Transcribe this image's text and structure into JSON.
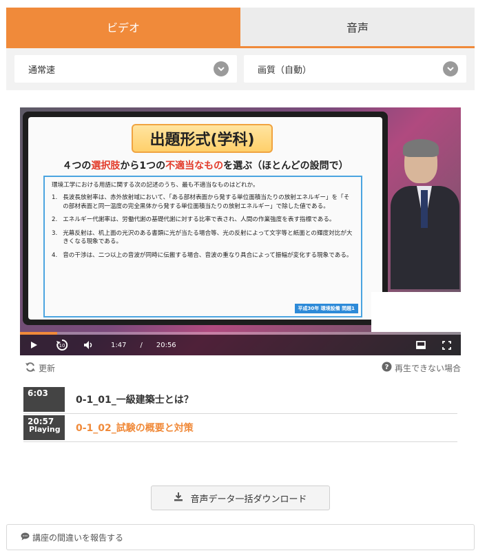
{
  "tabs": [
    {
      "label": "ビデオ",
      "active": true
    },
    {
      "label": "音声",
      "active": false
    }
  ],
  "selects": {
    "speed": "通常速",
    "quality": "画質（自動）"
  },
  "video": {
    "slide": {
      "title": "出題形式(学科)",
      "subtitle_parts": [
        "４つの",
        "選択肢",
        "から1つの",
        "不適当なもの",
        "を選ぶ（ほとんどの設問で）"
      ],
      "question": "環境工学における用語に関する次の記述のうち、最も不適当なものはどれか。",
      "items": [
        {
          "num": "1.",
          "text": "長波長放射率は、赤外放射域において、「ある部材表面から発する単位面積当たりの放射エネルギー」を「その部材表面と同一温度の完全黒体から発する単位面積当たりの放射エネルギー」で除した値である。"
        },
        {
          "num": "2.",
          "text": "エネルギー代謝率は、労働代謝の基礎代謝に対する比率で表され、人間の作業強度を表す指標である。"
        },
        {
          "num": "3.",
          "text": "光幕反射は、机上面の光沢のある書類に光が当たる場合等、光の反射によって文字等と紙面との輝度対比が大きくなる現象である。"
        },
        {
          "num": "4.",
          "text": "音の干渉は、二つ以上の音波が同時に伝搬する場合、音波の重なり具合によって振幅が変化する現象である。"
        }
      ],
      "tag": "平成30年 環境設備 問題1"
    },
    "current_time": "1:47",
    "separator": "/",
    "duration": "20:56",
    "progress": 0.085,
    "skip_seconds": "10"
  },
  "refresh_label": "更新",
  "help_label": "再生できない場合",
  "playlist": [
    {
      "duration": "6:03",
      "title": "0-1_01_一級建築士とは？",
      "playing": false,
      "badge": ""
    },
    {
      "duration": "20:57",
      "title": "0-1_02_試験の概要と対策",
      "playing": true,
      "badge": "Playing"
    }
  ],
  "download_label": "音声データ一括ダウンロード",
  "report_label": "講座の間違いを報告する",
  "colors": {
    "accent": "#f08a3a",
    "tag_blue": "#2d8ad8",
    "red": "#e23b2a"
  }
}
